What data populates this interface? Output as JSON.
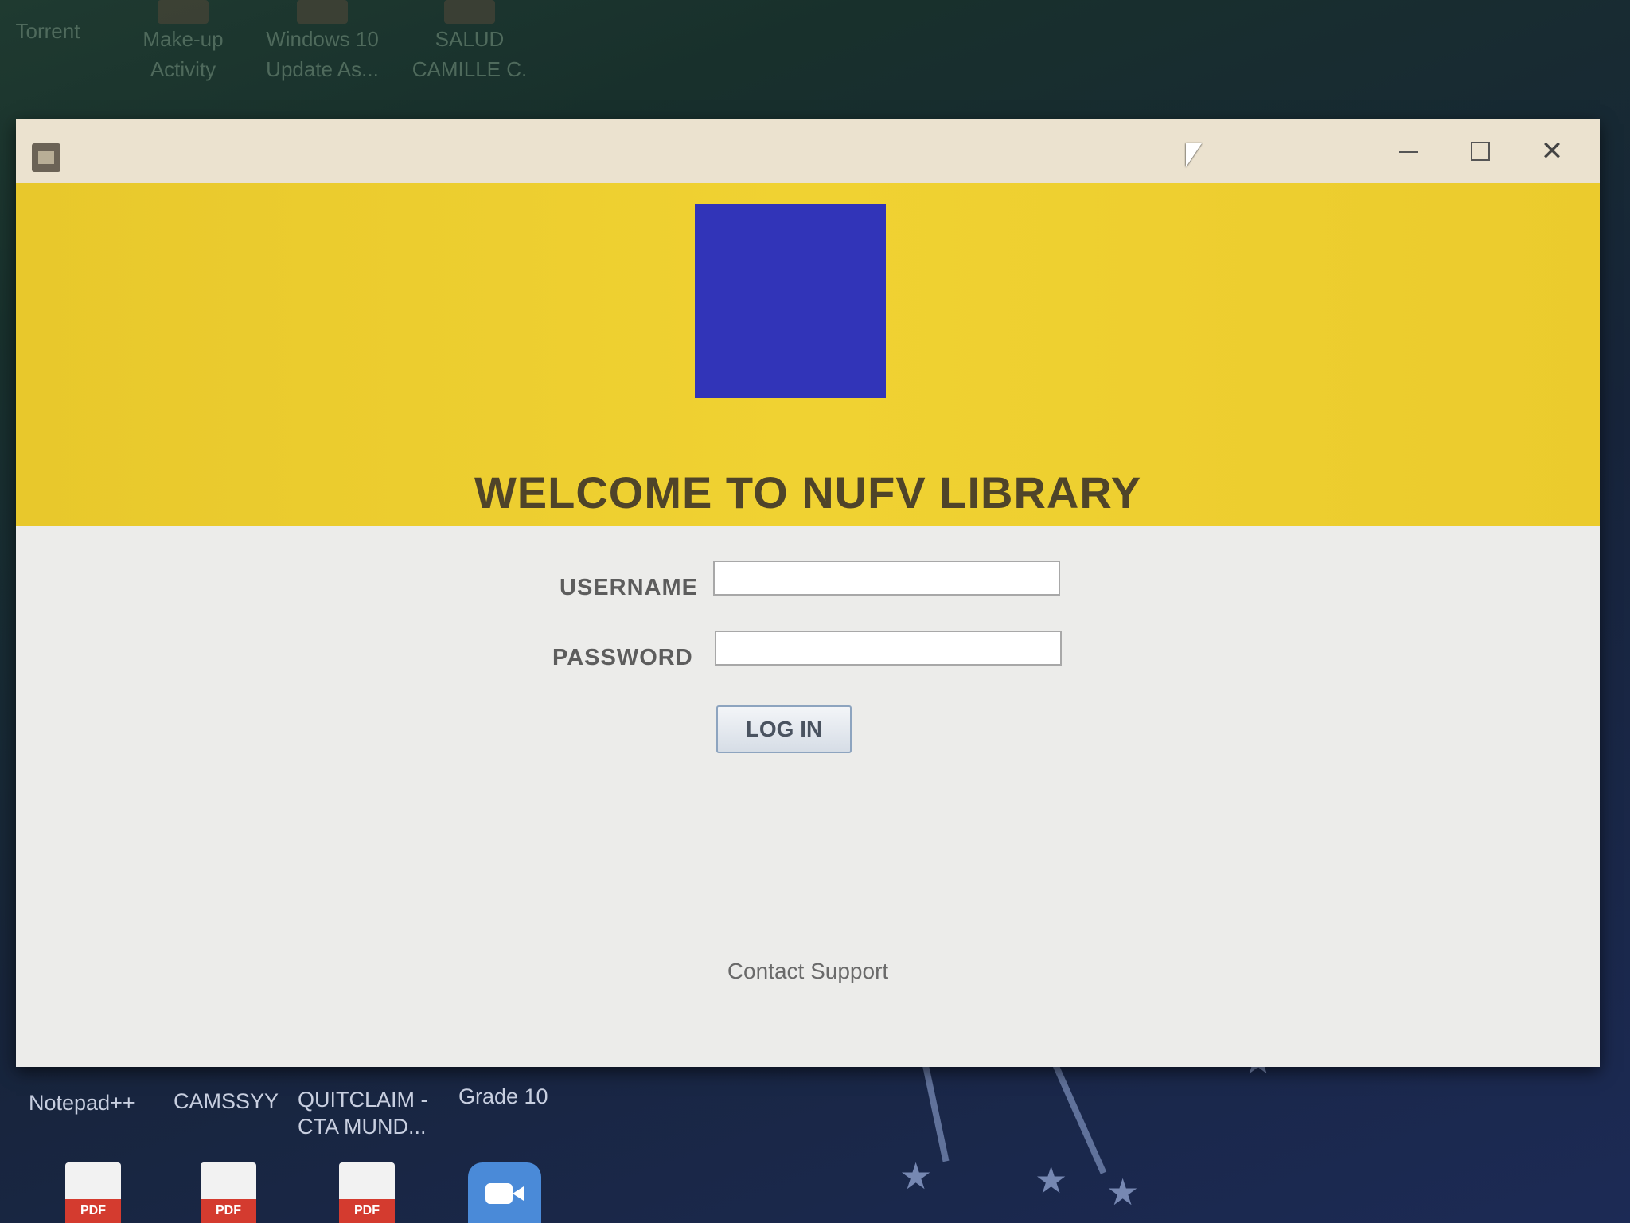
{
  "desktop": {
    "top_icons": [
      {
        "label_line1": "Torrent",
        "label_line2": ""
      },
      {
        "label_line1": "Make-up",
        "label_line2": "Activity"
      },
      {
        "label_line1": "Windows 10",
        "label_line2": "Update As..."
      },
      {
        "label_line1": "SALUD",
        "label_line2": "CAMILLE C."
      }
    ],
    "bottom_icons": [
      {
        "label_line1": "Notepad++",
        "label_line2": ""
      },
      {
        "label_line1": "CAMSSYY",
        "label_line2": ""
      },
      {
        "label_line1": "QUITCLAIM -",
        "label_line2": "CTA MUND..."
      },
      {
        "label_line1": "Grade 10",
        "label_line2": ""
      }
    ],
    "pdf_tag": "PDF"
  },
  "window": {
    "minimize_icon": "minimize-icon",
    "maximize_icon": "maximize-icon",
    "close_symbol": "✕"
  },
  "banner": {
    "welcome_text": "WELCOME TO NUFV LIBRARY",
    "background_color": "#ecd02f",
    "logo_color": "#3134b8"
  },
  "form": {
    "username_label": "USERNAME",
    "username_value": "",
    "password_label": "PASSWORD",
    "password_value": "",
    "login_button": "LOG IN",
    "contact_link": "Contact Support"
  }
}
